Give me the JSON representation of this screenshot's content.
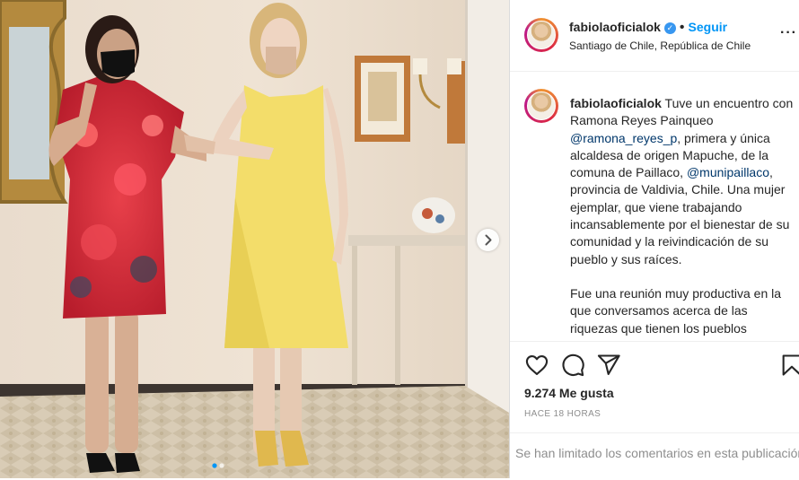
{
  "post": {
    "username": "fabiolaoficialok",
    "verified_mark": "✓",
    "separator": "•",
    "follow_label": "Seguir",
    "location": "Santiago de Chile, República de Chile",
    "more_label": "···"
  },
  "caption": {
    "username": "fabiolaoficialok",
    "part1": " Tuve un encuentro con Ramona Reyes Painqueo ",
    "mention1": "@ramona_reyes_p",
    "part2": ", primera y única alcaldesa de origen Mapuche, de la comuna de Paillaco, ",
    "mention2": "@munipaillaco",
    "part3": ", provincia de Valdivia, Chile. Una mujer ejemplar, que viene trabajando incansablemente por el bienestar de su comunidad y la reivindicación de su pueblo y sus raíces.",
    "paragraph2": "Fue una reunión muy productiva en la que conversamos acerca de las riquezas que tienen los pueblos"
  },
  "stats": {
    "likes": "9.274 Me gusta",
    "time": "HACE 18 HORAS"
  },
  "comments": {
    "limited_text": "Se han limitado los comentarios en esta publicación"
  },
  "icons": {
    "like": "heart-icon",
    "comment": "comment-icon",
    "share": "paper-plane-icon",
    "save": "bookmark-icon",
    "next": "chevron-right-icon"
  },
  "colors": {
    "accent": "#0095f6",
    "verified": "#3897f0",
    "mention": "#00376b",
    "muted": "#8e8e8e"
  }
}
